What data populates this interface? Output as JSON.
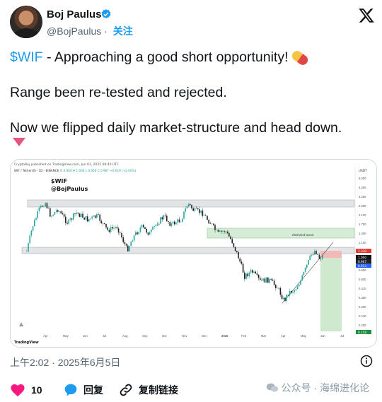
{
  "author": {
    "name": "Boj Paulus",
    "handle": "@BojPaulus",
    "separator": "·",
    "follow_label": "关注"
  },
  "tweet": {
    "cashtag": "$WIF",
    "line1_rest": " - Approaching a good short opportunity!",
    "line2": "Range been re-tested and rejected.",
    "line3": "Now we flipped daily market-structure and head down."
  },
  "chart": {
    "attribution": "CryptoBoj published on TradingView.com, Jun 03, 2025 08:40 UTC",
    "symbol_line": "WIF / TetherUS · 1D · BINANCE",
    "quote": "O 0.960  H 1.000  L 0.950  C 0.967  +0.019 (+2.00%)",
    "title": "$WIF",
    "handle": "@BojPaulus",
    "currency": "USDT",
    "zone_label": "demand zone",
    "logo": "TradingView",
    "price_ticks": [
      "5.000",
      "4.000",
      "3.250",
      "2.600",
      "2.100",
      "1.700",
      "1.400",
      "1.100",
      "0.900",
      "0.750",
      "0.600",
      "0.500",
      "0.410",
      "0.350",
      "0.290",
      "0.240",
      "0.200"
    ],
    "price_tags": {
      "red": "1.330",
      "black": "0.967",
      "black2": "1.000",
      "blue": "0.913",
      "green": "0.158"
    },
    "x_ticks": [
      "Apr",
      "May",
      "Jun",
      "Jul",
      "Aug",
      "Sep",
      "Oct",
      "Nov",
      "Dec",
      "2025",
      "Feb",
      "Mar",
      "Apr",
      "May",
      "Jun",
      "Jul"
    ]
  },
  "timestamp": "上午2:02 · 2025年6月5日",
  "actions": {
    "likes": "10",
    "reply": "回复",
    "copy_link": "复制链接"
  },
  "watermark": "公众号 · 海绵进化论",
  "colors": {
    "link": "#1d9bf0",
    "like": "#f91880",
    "candle_up": "#26a69a",
    "candle_down": "#222222"
  }
}
